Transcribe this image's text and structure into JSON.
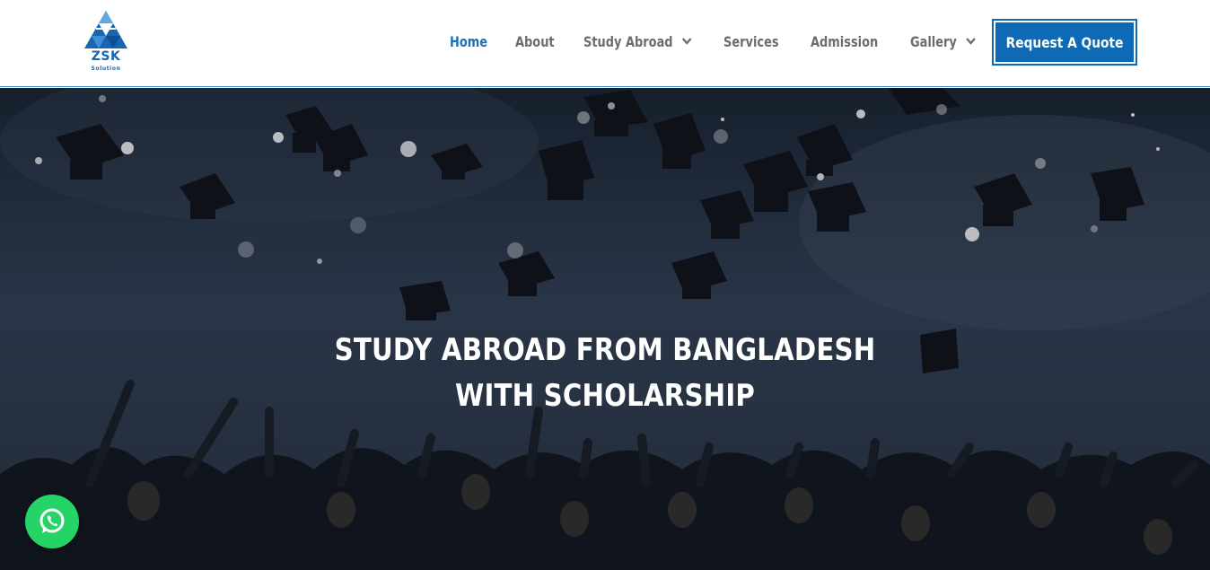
{
  "logo": {
    "name": "ZSK",
    "sub": "Solution"
  },
  "nav": {
    "items": [
      {
        "label": "Home",
        "active": true,
        "dropdown": false
      },
      {
        "label": "About",
        "active": false,
        "dropdown": false
      },
      {
        "label": "Study Abroad",
        "active": false,
        "dropdown": true
      },
      {
        "label": "Services",
        "active": false,
        "dropdown": false
      },
      {
        "label": "Admission",
        "active": false,
        "dropdown": false
      },
      {
        "label": "Gallery",
        "active": false,
        "dropdown": true
      }
    ],
    "cta_label": "Request A Quote"
  },
  "hero": {
    "title_line1": "STUDY ABROAD FROM BANGLADESH",
    "title_line2": "WITH SCHOLARSHIP"
  },
  "colors": {
    "brand": "#0e6ab6",
    "nav_active": "#1e6fb8",
    "nav_text": "#6c6c6c",
    "whatsapp": "#25d366"
  },
  "icons": [
    "chevron-down-icon",
    "whatsapp-icon"
  ]
}
